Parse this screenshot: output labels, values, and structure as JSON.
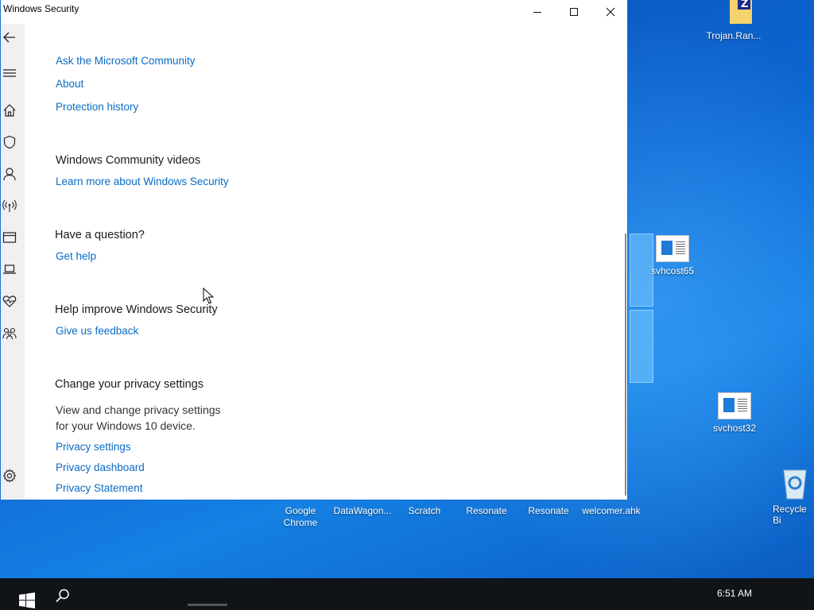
{
  "window": {
    "title": "Windows Security",
    "controls": {
      "minimize": "minimize",
      "maximize": "maximize",
      "close": "close"
    }
  },
  "sidebar": {
    "icons": [
      "back-icon",
      "menu-icon",
      "home-icon",
      "shield-icon",
      "account-icon",
      "firewall-icon",
      "app-browser-icon",
      "device-security-icon",
      "health-icon",
      "family-icon",
      "settings-icon"
    ]
  },
  "content": {
    "links_top": [
      "Ask the Microsoft Community",
      "About",
      "Protection history"
    ],
    "community_videos": {
      "heading": "Windows Community videos",
      "link": "Learn more about Windows Security"
    },
    "question": {
      "heading": "Have a question?",
      "link": "Get help"
    },
    "improve": {
      "heading": "Help improve Windows Security",
      "link": "Give us feedback"
    },
    "privacy": {
      "heading": "Change your privacy settings",
      "description_line1": "View and change privacy settings",
      "description_line2": "for your Windows 10 device.",
      "links": [
        "Privacy settings",
        "Privacy dashboard",
        "Privacy Statement"
      ]
    }
  },
  "desktop": {
    "icons": [
      {
        "label": "Trojan.Ran..."
      },
      {
        "label": "svhcost65"
      },
      {
        "label": "svchost32"
      },
      {
        "label": "Recycle Bi"
      }
    ],
    "bottom_labels": [
      {
        "line1": "Google",
        "line2": "Chrome"
      },
      {
        "line1": "DataWagon..."
      },
      {
        "line1": "Scratch"
      },
      {
        "line1": "Resonate"
      },
      {
        "line1": "Resonate"
      },
      {
        "line1": "welcomer.ahk"
      }
    ]
  },
  "taskbar": {
    "clock": "6:51 AM"
  }
}
